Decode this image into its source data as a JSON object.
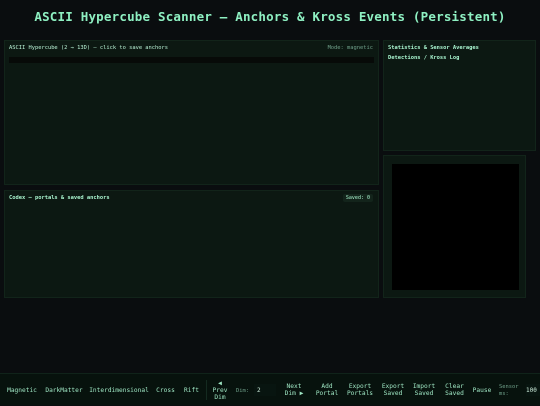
{
  "title": "ASCII Hypercube Scanner — Anchors & Kross Events (Persistent)",
  "viewport": {
    "heading": "ASCII Hypercube (2 → 13D) — click to save anchors",
    "mode": "Mode: magnetic"
  },
  "codex": {
    "heading": "Codex — portals & saved anchors",
    "saved": "Saved: 0"
  },
  "stats": {
    "heading": "Statistics & Sensor Averages",
    "log_heading": "Detections / Kross Log"
  },
  "toolbar": {
    "magnetic": "Magnetic",
    "darkmatter": "DarkMatter",
    "interdimensional": "Interdimensional",
    "cross": "Cross",
    "rift": "Rift",
    "prev_dim": "◀\nPrev\nDim",
    "dim_label": "Dim:",
    "dim_value": "2",
    "next_dim": "Next\nDim ▶",
    "add_portal": "Add\nPortal",
    "export_portals": "Export\nPortals",
    "export_saved": "Export\nSaved",
    "import_saved": "Import\nSaved",
    "clear_saved": "Clear\nSaved",
    "pause": "Pause",
    "sensor_label": "Sensor\nms:",
    "sensor_value": "100"
  },
  "colors": {
    "accent": "#8ef0c2",
    "panel": "#0c1812",
    "background": "#0a0d0f"
  }
}
